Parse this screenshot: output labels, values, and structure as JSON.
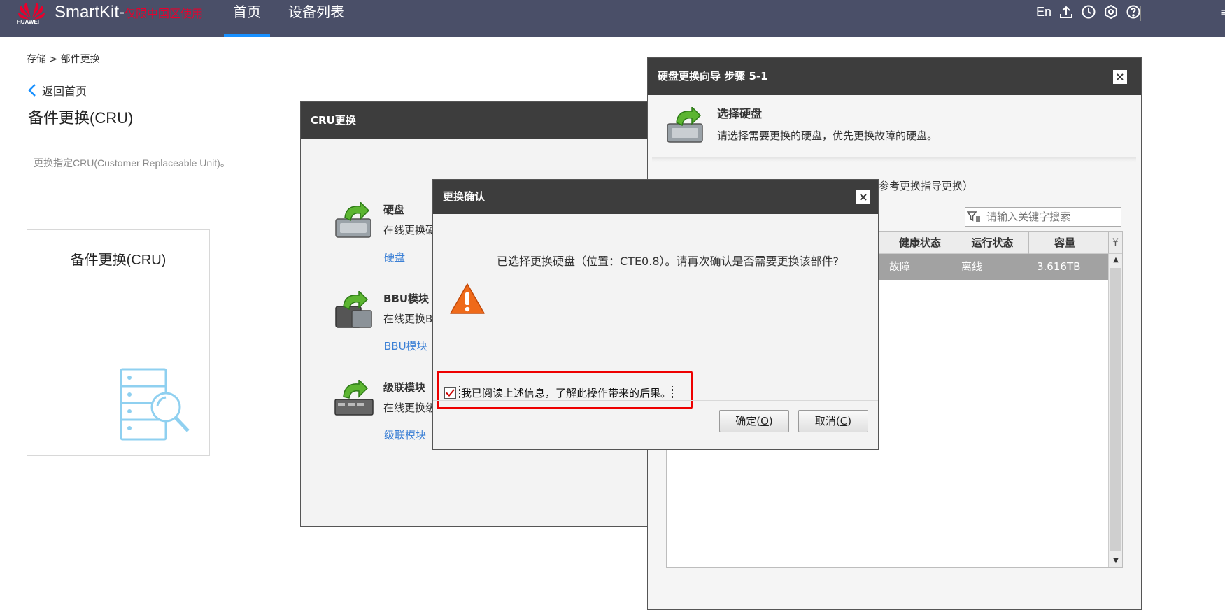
{
  "topbar": {
    "brand_small": "HUAWEI",
    "app_name": "SmartKit-",
    "app_region_note": "仅限中国区使用",
    "nav": [
      {
        "label": "首页",
        "active": true
      },
      {
        "label": "设备列表",
        "active": false
      }
    ],
    "lang": "En",
    "icons": [
      "upload-icon",
      "clock-icon",
      "settings-icon",
      "help-icon"
    ],
    "accent_color": "#1890ff",
    "bg_color": "#4a4f68"
  },
  "page": {
    "breadcrumb": "存储 > 部件更换",
    "back_label": "返回首页",
    "title": "备件更换(CRU)",
    "description": "更换指定CRU(Customer Replaceable Unit)。",
    "card_title": "备件更换(CRU)"
  },
  "cru_window": {
    "title": "CRU更换",
    "items": [
      {
        "title": "硬盘",
        "desc": "在线更换硬",
        "link": "硬盘"
      },
      {
        "title": "BBU模块",
        "desc": "在线更换B",
        "link": "BBU模块"
      },
      {
        "title": "级联模块",
        "desc": "在线更换级",
        "link": "级联模块"
      }
    ]
  },
  "wizard": {
    "title": "硬盘更换向导 步骤 5-1",
    "step_title": "选择硬盘",
    "step_desc": "请选择需要更换的硬盘，优先更换故障的硬盘。",
    "note": "参考更换指导更换）",
    "search_placeholder": "请输入关键字搜索",
    "columns": [
      "健康状态",
      "运行状态",
      "容量"
    ],
    "rows": [
      {
        "health": "故障",
        "running": "离线",
        "capacity": "3.616TB"
      }
    ]
  },
  "confirm": {
    "title": "更换确认",
    "message": "已选择更换硬盘（位置：CTE0.8）。请再次确认是否需要更换该部件?",
    "ack_label": "我已阅读上述信息，了解此操作带来的后果。",
    "ack_checked": true,
    "ok_label": "确定(",
    "ok_key": "O",
    "ok_close": ")",
    "cancel_label": "取消(",
    "cancel_key": "C",
    "cancel_close": ")"
  }
}
